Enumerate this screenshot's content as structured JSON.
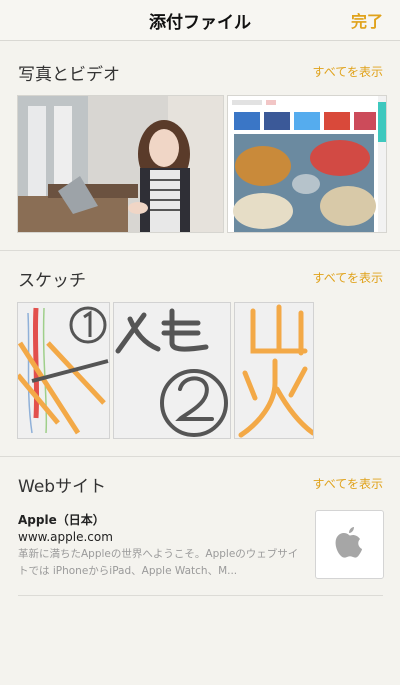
{
  "navbar": {
    "title": "添付ファイル",
    "done_label": "完了"
  },
  "sections": {
    "photos": {
      "title": "写真とビデオ",
      "show_all": "すべてを表示"
    },
    "sketches": {
      "title": "スケッチ",
      "show_all": "すべてを表示"
    },
    "websites": {
      "title": "Webサイト",
      "show_all": "すべてを表示"
    }
  },
  "website_item": {
    "title": "Apple（日本）",
    "url": "www.apple.com",
    "description": "革新に満ちたAppleの世界へようこそ。Appleのウェブサイトでは iPhoneからiPad、Apple Watch、M..."
  },
  "photo_items": [
    {
      "icon": "portrait-photo"
    },
    {
      "icon": "webpage-screenshot-sneakers"
    }
  ],
  "sketch_items": [
    {
      "icon": "sketch-colored-lines-1"
    },
    {
      "icon": "sketch-memo-2"
    },
    {
      "icon": "sketch-kanji"
    }
  ],
  "colors": {
    "accent": "#e0a21b",
    "background": "#f4f3ee"
  }
}
